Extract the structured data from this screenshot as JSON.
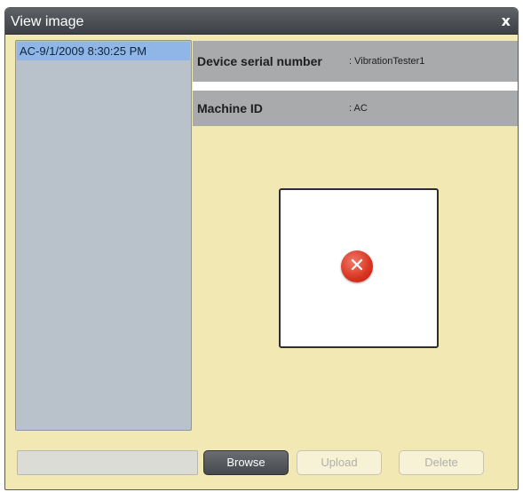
{
  "window": {
    "title": "View image",
    "close_label": "x"
  },
  "list": {
    "items": [
      "AC-9/1/2009 8:30:25 PM"
    ]
  },
  "details": {
    "device_serial_label": "Device serial number",
    "device_serial_value": ": VibrationTester1",
    "machine_id_label": "Machine ID",
    "machine_id_value": ": AC"
  },
  "preview": {
    "state_icon": "error-icon",
    "icon_glyph": "✕"
  },
  "footer": {
    "path_value": "",
    "browse_label": "Browse",
    "upload_label": "Upload",
    "delete_label": "Delete"
  },
  "colors": {
    "panel_bg": "#f2e8b4",
    "titlebar": "#45484c",
    "list_bg": "#b9c2cb",
    "selection": "#8fb6e6",
    "info_row": "#a8aaac",
    "error": "#d8331f"
  }
}
